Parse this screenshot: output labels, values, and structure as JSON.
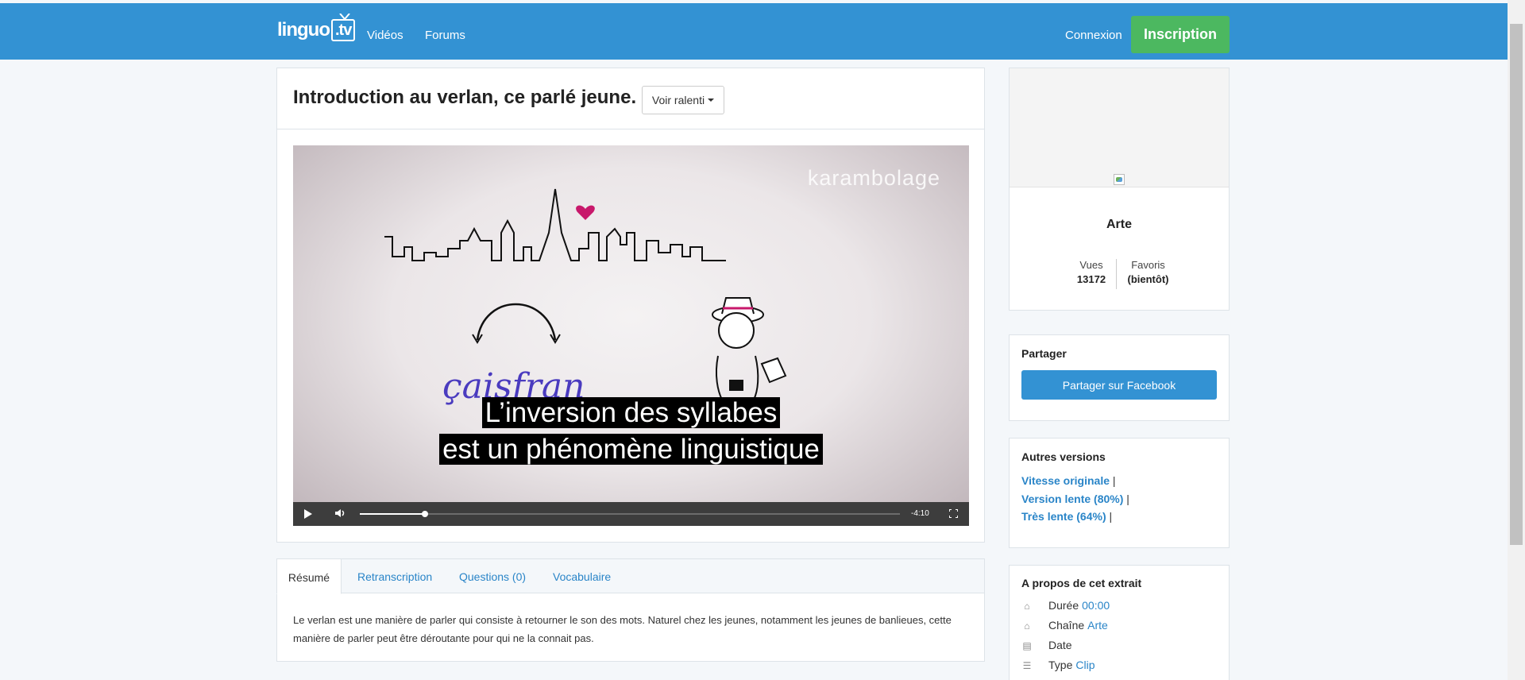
{
  "nav": {
    "logo_text": "linguo",
    "logo_tv": ".tv",
    "videos": "Vidéos",
    "forums": "Forums",
    "connexion": "Connexion",
    "inscription": "Inscription"
  },
  "video_page": {
    "title": "Introduction au verlan, ce parlé jeune.",
    "ralenti_button": "Voir ralenti",
    "player": {
      "watermark": "karambolage",
      "caption_line1": "L’inversion des syllabes",
      "caption_line2": "est un phénomène linguistique",
      "time_remaining": "-4:10",
      "progress_fraction": 0.12
    }
  },
  "tabs": {
    "items": [
      "Résumé",
      "Retranscription",
      "Questions (0)",
      "Vocabulaire"
    ],
    "active": "Résumé",
    "content": "Le verlan est une manière de parler qui consiste à retourner le son des mots. Naturel chez les jeunes, notamment les jeunes de banlieues, cette manière de parler peut être déroutante pour qui ne la connait pas."
  },
  "channel": {
    "name": "Arte",
    "views_label": "Vues",
    "views_value": "13172",
    "favorites_label": "Favoris",
    "favorites_value": "(bientôt)"
  },
  "share": {
    "heading": "Partager",
    "facebook_button": "Partager sur Facebook"
  },
  "versions": {
    "heading": "Autres versions",
    "items": [
      "Vitesse originale",
      "Version lente (80%)",
      "Très lente (64%)"
    ],
    "separator": "|"
  },
  "about": {
    "heading": "A propos de cet extrait",
    "duration_label": "Durée",
    "duration_value": "00:00",
    "channel_label": "Chaîne",
    "channel_value": "Arte",
    "date_label": "Date",
    "type_label": "Type",
    "type_value": "Clip"
  },
  "colors": {
    "navbar": "#3392d3",
    "inscription": "#4cb860",
    "link": "#2a85c8"
  }
}
